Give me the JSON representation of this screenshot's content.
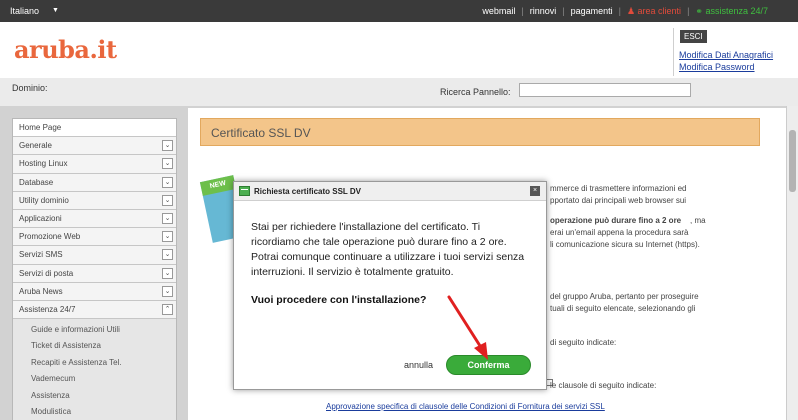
{
  "topbar": {
    "language": "Italiano",
    "links": [
      "webmail",
      "rinnovi",
      "pagamenti"
    ],
    "area_clienti": "area clienti",
    "assistenza": "assistenza 24/7"
  },
  "header": {
    "logo": "aruba.it",
    "esci": "ESCI",
    "modifica_anagrafici": "Modifica Dati Anagrafici",
    "modifica_password": "Modifica Password"
  },
  "domainbar": {
    "dominio_label": "Dominio:",
    "search_label": "Ricerca Pannello:",
    "search_value": ""
  },
  "sidebar": {
    "items": [
      "Home Page",
      "Generale",
      "Hosting Linux",
      "Database",
      "Utility dominio",
      "Applicazioni",
      "Promozione Web",
      "Servizi SMS",
      "Servizi di posta",
      "Aruba News",
      "Assistenza 24/7"
    ],
    "subitems": [
      "Guide e informazioni Utili",
      "Ticket di Assistenza",
      "Recapiti e Assistenza Tel.",
      "Vademecum",
      "Assistenza",
      "Modulistica"
    ]
  },
  "main": {
    "title": "Certificato SSL DV",
    "new_badge": "NEW",
    "bg_lines": [
      "mmerce di trasmettere informazioni ed",
      "pportato dai principali web browser sui",
      "operazione può durare fino a 2 ore",
      ", ma",
      "erai un'email appena la procedura sarà",
      "li comunicazione sicura su Internet (https).",
      "del gruppo Aruba, pertanto per proseguire",
      "tuali di seguito elencate, selezionando gli",
      "di seguito indicate:",
      "le clausole di seguito indicate:"
    ],
    "bottom_link": "Approvazione specifica di clausole delle Condizioni di Fornitura dei servizi SSL"
  },
  "modal": {
    "title": "Richiesta certificato SSL DV",
    "close": "×",
    "body": "Stai per richiedere l'installazione del certificato. Ti ricordiamo che tale operazione può durare fino a 2 ore. Potrai comunque continuare a utilizzare i tuoi servizi senza interruzioni. Il servizio è totalmente gratuito.",
    "question": "Vuoi procedere con l'installazione?",
    "cancel": "annulla",
    "confirm": "Conferma"
  },
  "colors": {
    "accent": "#e9673d",
    "confirm": "#3aab3a",
    "header_band": "#f3c58a",
    "arrow": "#e02020"
  },
  "icons": {
    "user": "user-icon",
    "headset": "headset-icon",
    "modal": "certificate-icon",
    "close": "close-icon",
    "chevron": "chevron-down-icon"
  }
}
